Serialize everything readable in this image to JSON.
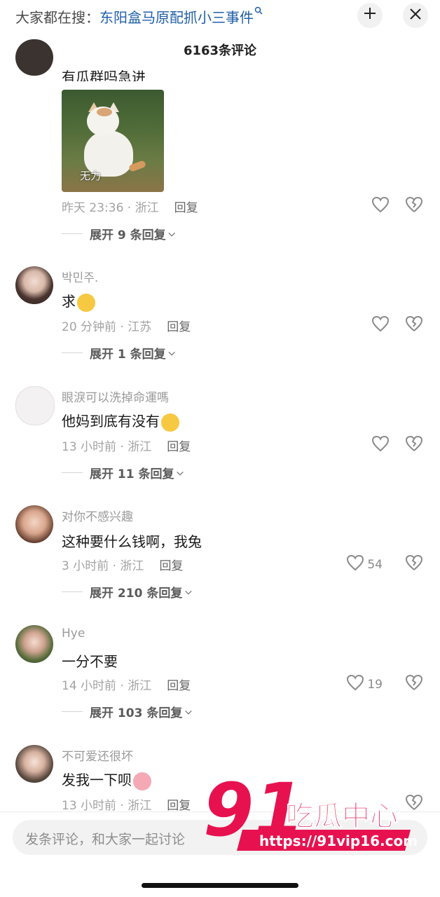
{
  "header": {
    "search_prefix": "大家都在搜：",
    "search_query": "东阳盒马原配抓小三事件",
    "search_icon": "search-icon",
    "collapse_icon": "collapse-icon",
    "close_icon": "close-icon",
    "comment_count": "6163条评论"
  },
  "comments": [
    {
      "text": "有瓜群吗急进",
      "sticker_caption": "无力",
      "time_location": "昨天 23:36 · 浙江",
      "reply_label": "回复",
      "expand_label": "展开 9 条回复"
    },
    {
      "username": "박민주.",
      "text": "求",
      "time_location": "20 分钟前 · 江苏",
      "reply_label": "回复",
      "expand_label": "展开 1 条回复"
    },
    {
      "username": "眼淚可以洗掉命運嗎",
      "text": "他妈到底有没有",
      "time_location": "13 小时前 · 浙江",
      "reply_label": "回复",
      "expand_label": "展开 11 条回复"
    },
    {
      "username": "对你不感兴趣",
      "text": "这种要什么钱啊，我兔",
      "time_location": "3 小时前 · 浙江",
      "reply_label": "回复",
      "like_count": "54",
      "expand_label": "展开 210 条回复"
    },
    {
      "username": "Hye",
      "text": "一分不要",
      "time_location": "14 小时前 · 浙江",
      "reply_label": "回复",
      "like_count": "19",
      "expand_label": "展开 103 条回复"
    },
    {
      "username": "不可爱还很坏",
      "text": "发我一下呗",
      "time_location": "13 小时前 · 浙江",
      "reply_label": "回复"
    }
  ],
  "input": {
    "placeholder": "发条评论，和大家一起讨论"
  },
  "watermark": {
    "logo_text": "91吃瓜中心",
    "url": "https://91vip16.com"
  },
  "colors": {
    "search_query": "#1f5fa8",
    "watermark": "#e8114f"
  }
}
